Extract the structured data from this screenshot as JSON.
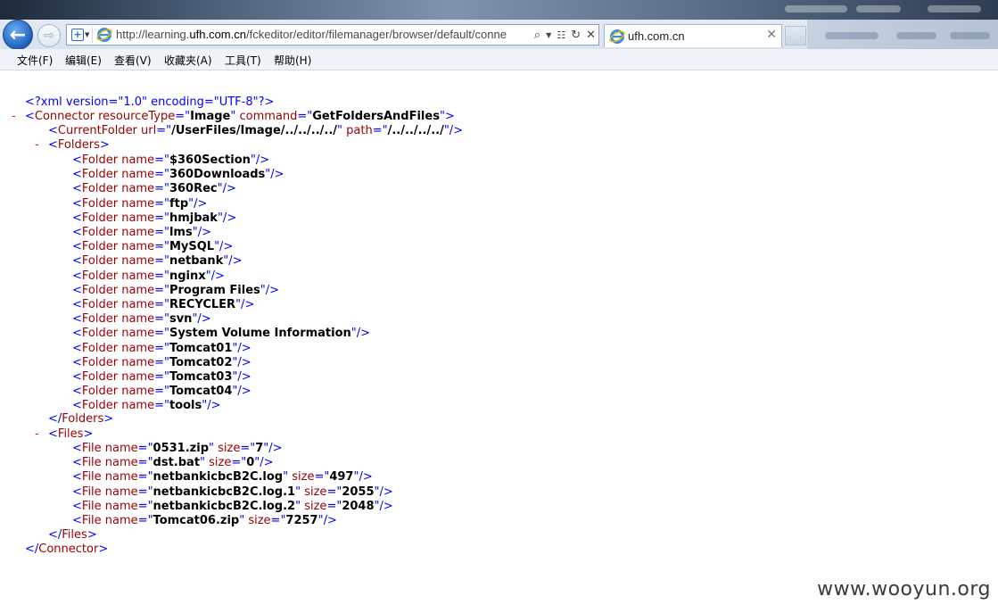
{
  "browser": {
    "address_url_prefix": "http://learning.",
    "address_url_domain": "ufh.com.cn",
    "address_url_suffix": "/fckeditor/editor/filemanager/browser/default/conne",
    "tab_title": "ufh.com.cn",
    "icons": [
      "back-arrow-icon",
      "forward-arrow-icon",
      "compatibility-view-icon",
      "ie-logo-icon",
      "search-icon",
      "dropdown-icon",
      "refresh-icon",
      "stop-icon",
      "close-icon"
    ]
  },
  "menu": {
    "file": "文件(F)",
    "edit": "编辑(E)",
    "view": "查看(V)",
    "favorites": "收藏夹(A)",
    "tools": "工具(T)",
    "help": "帮助(H)"
  },
  "xml": {
    "decl": "<?xml version=\"1.0\" encoding=\"UTF-8\"?>",
    "connector_resource_type": "Image",
    "connector_command": "GetFoldersAndFiles",
    "current_folder_url": "/UserFiles/Image/../../../../",
    "current_folder_path": "/../../../../",
    "folders": [
      "$360Section",
      "360Downloads",
      "360Rec",
      "ftp",
      "hmjbak",
      "lms",
      "MySQL",
      "netbank",
      "nginx",
      "Program Files",
      "RECYCLER",
      "svn",
      "System Volume Information",
      "Tomcat01",
      "Tomcat02",
      "Tomcat03",
      "Tomcat04",
      "tools"
    ],
    "files": [
      {
        "name": "0531.zip",
        "size": "7"
      },
      {
        "name": "dst.bat",
        "size": "0"
      },
      {
        "name": "netbankicbcB2C.log",
        "size": "497"
      },
      {
        "name": "netbankicbcB2C.log.1",
        "size": "2055"
      },
      {
        "name": "netbankicbcB2C.log.2",
        "size": "2048"
      },
      {
        "name": "Tomcat06.zip",
        "size": "7257"
      }
    ]
  },
  "watermark": "www.wooyun.org"
}
